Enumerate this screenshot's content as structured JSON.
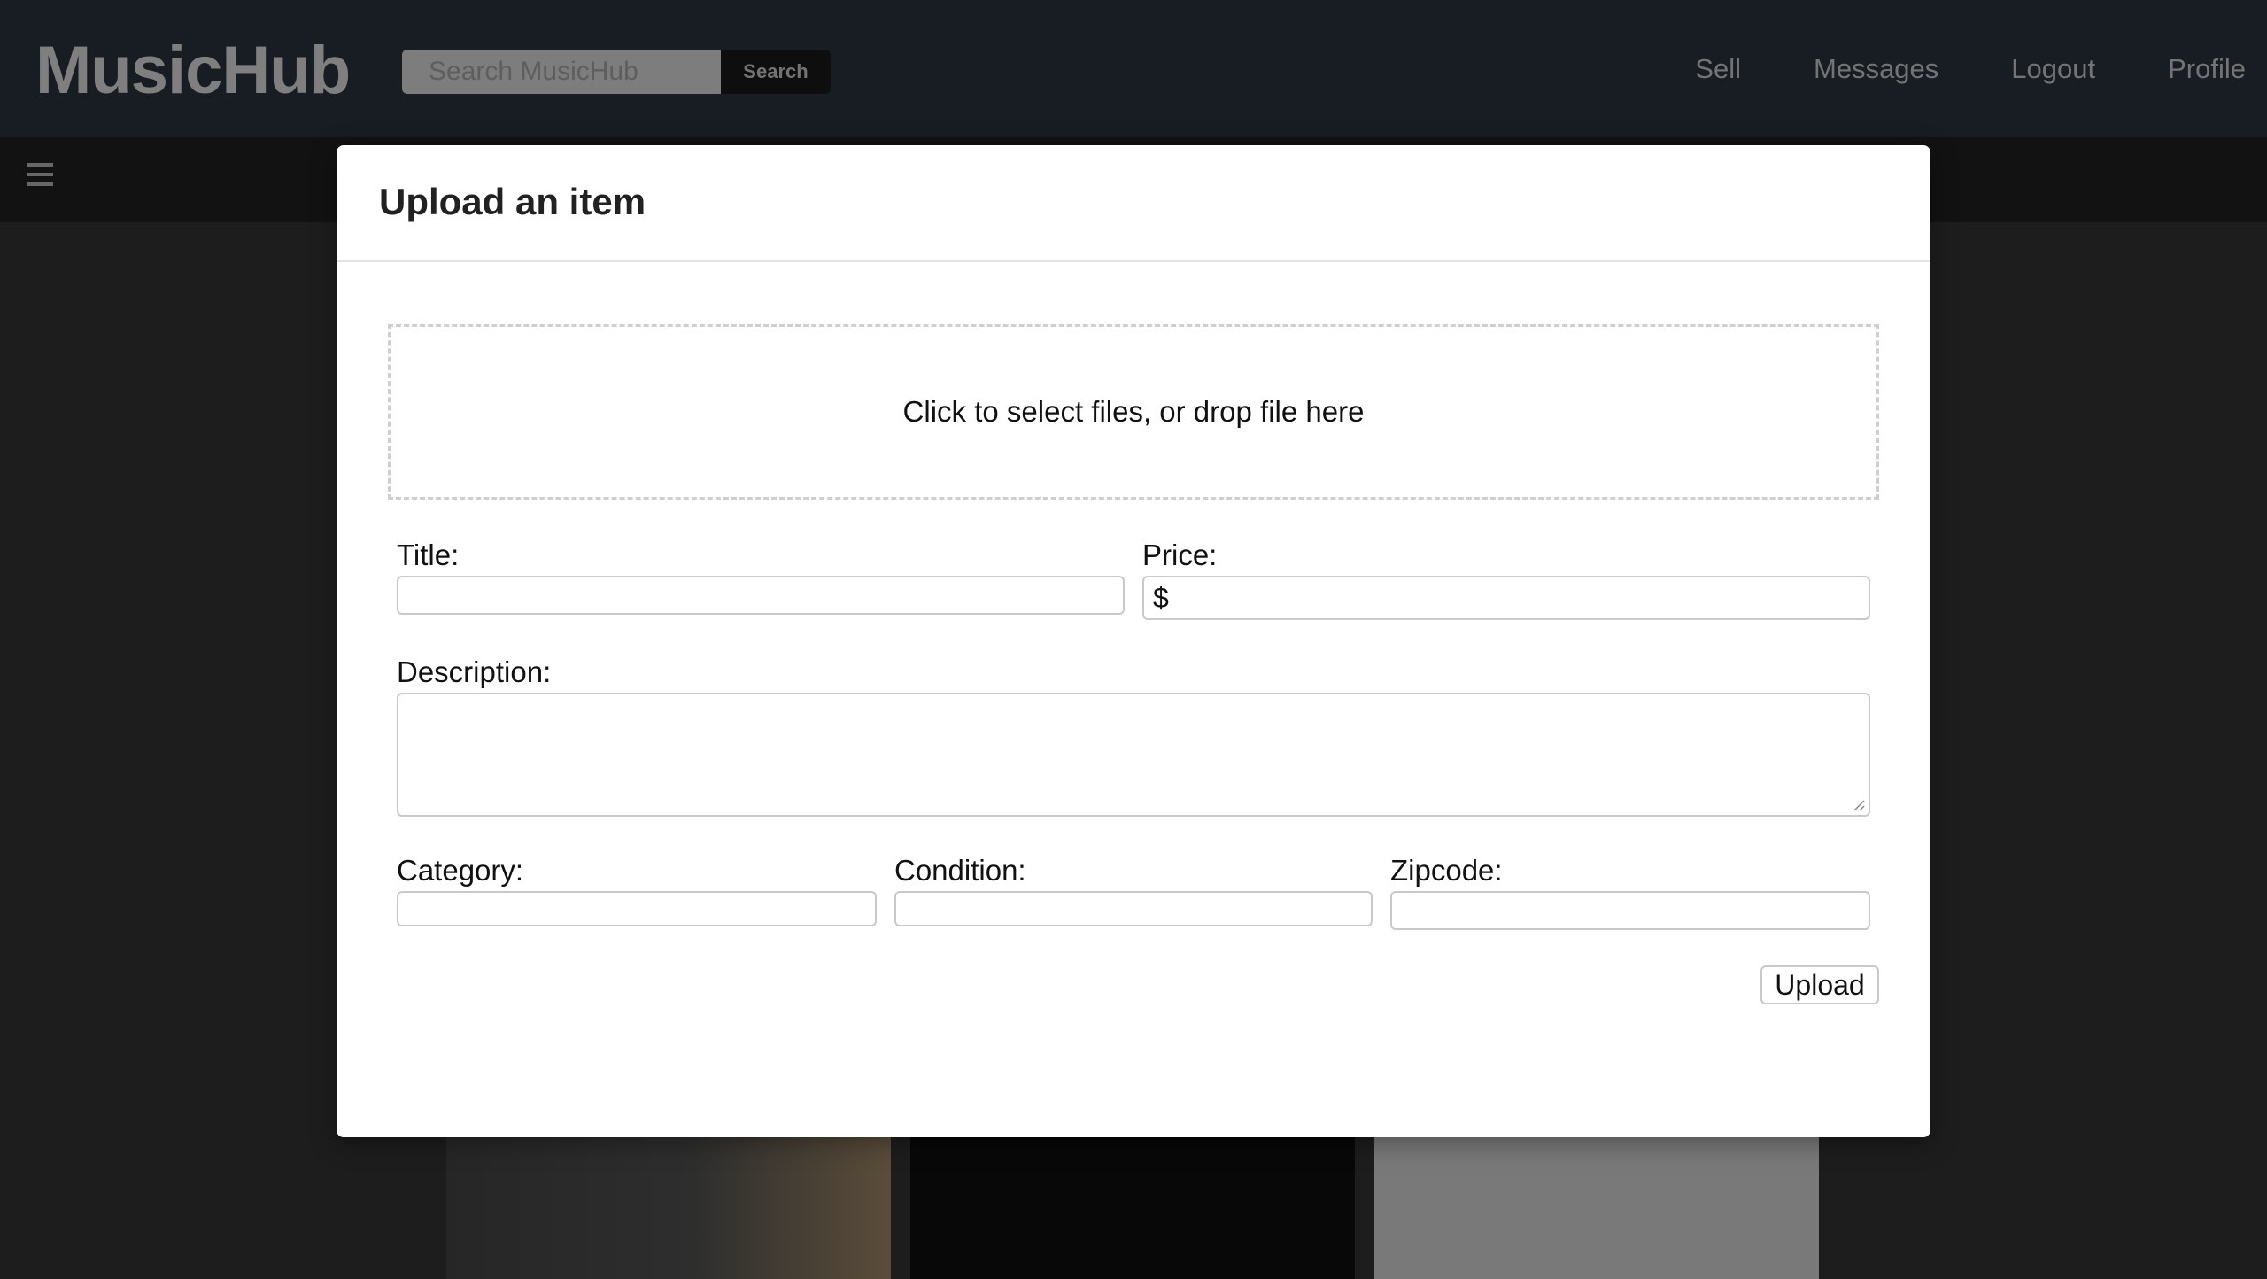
{
  "header": {
    "logo": "MusicHub",
    "search": {
      "placeholder": "Search MusicHub",
      "button_label": "Search"
    },
    "nav": [
      "Sell",
      "Messages",
      "Logout",
      "Profile"
    ]
  },
  "modal": {
    "title": "Upload an item",
    "dropzone_text": "Click to select files, or drop file here",
    "fields": {
      "title_label": "Title:",
      "price_label": "Price:",
      "price_prefix": "$",
      "description_label": "Description:",
      "category_label": "Category:",
      "condition_label": "Condition:",
      "zipcode_label": "Zipcode:"
    },
    "upload_label": "Upload"
  },
  "icons": {
    "menu": "hamburger-icon",
    "resize": "resize-grip-icon"
  }
}
